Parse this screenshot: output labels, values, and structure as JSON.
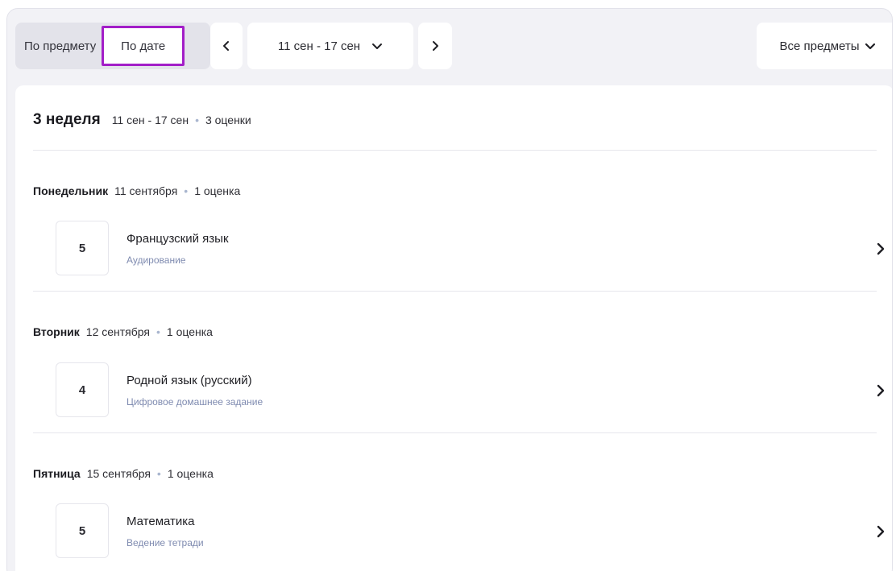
{
  "toolbar": {
    "tab_by_subject": "По предмету",
    "tab_by_date": "По дате",
    "date_range": "11 сен - 17 сен",
    "subjects_filter": "Все предметы"
  },
  "week": {
    "title": "3 неделя",
    "range": "11 сен - 17 сен",
    "count": "3 оценки"
  },
  "days": [
    {
      "name": "Понедельник",
      "date": "11 сентября",
      "count": "1 оценка",
      "grade": "5",
      "subject": "Французский язык",
      "work": "Аудирование"
    },
    {
      "name": "Вторник",
      "date": "12 сентября",
      "count": "1 оценка",
      "grade": "4",
      "subject": "Родной язык (русский)",
      "work": "Цифровое домашнее задание"
    },
    {
      "name": "Пятница",
      "date": "15 сентября",
      "count": "1 оценка",
      "grade": "5",
      "subject": "Математика",
      "work": "Ведение тетради"
    }
  ],
  "colors": {
    "highlight": "#a31ec8",
    "work_text": "#7f8bb0",
    "separator_dot": "#a9b6cf"
  }
}
